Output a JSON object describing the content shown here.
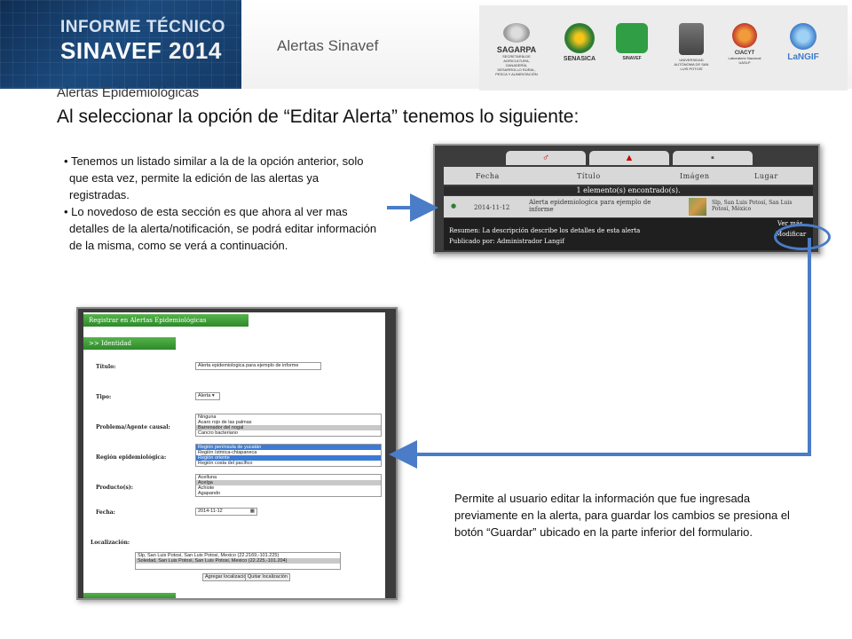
{
  "header": {
    "banner_line1": "INFORME TÉCNICO",
    "banner_line2": "SINAVEF",
    "banner_year": "2014",
    "section_title": "Alertas Sinavef",
    "logos": [
      {
        "name": "SAGARPA",
        "caption": "SECRETARÍA DE AGRICULTURA, GANADERÍA, DESARROLLO RURAL, PESCA Y ALIMENTACIÓN",
        "color": "#7a1f2b"
      },
      {
        "name": "SENASICA",
        "caption": "",
        "color": "#2e7d32"
      },
      {
        "name": "SINAVEF",
        "caption": "",
        "color": "#2f9e44"
      },
      {
        "name": "",
        "caption": "UNIVERSIDAD AUTÓNOMA DE SAN LUIS POTOSÍ",
        "color": "#555555"
      },
      {
        "name": "CIACYT",
        "caption": "Laboratorio Nacional UASLP",
        "color": "#d9822b"
      },
      {
        "name": "LaNGIF",
        "caption": "",
        "color": "#3d7dca"
      }
    ]
  },
  "subtitle": "Alertas Epidemiológicas",
  "main_title": "Al seleccionar la opción de “Editar Alerta” tenemos lo siguiente:",
  "bullets": [
    "Tenemos un listado similar a la de la opción anterior, solo que esta vez, permite la edición de las alertas ya registradas.",
    "Lo novedoso de esta sección es que ahora al ver mas detalles de la alerta/notificación, se podrá editar información de la misma, como se verá a continuación."
  ],
  "list_screenshot": {
    "columns": [
      "Fecha",
      "Título",
      "Imágen",
      "Lugar"
    ],
    "found_text": "1 elemento(s) encontrado(s).",
    "row": {
      "date": "2014-11-12",
      "title": "Alerta epidemiologica para ejemplo de informe",
      "place": "Slp, San Luis Potosí, San Luis Potosí, México"
    },
    "summary": "Resumen: La descripción describe los detalles de esta alerta",
    "published_by": "Publicado por: Administrador Langif",
    "see_more": "Ver más",
    "modify": "Modificar"
  },
  "form_screenshot": {
    "header": "Registrar en Alertas Epidemiológicas",
    "section": ">> Identidad",
    "fields": {
      "titulo_label": "Título:",
      "titulo_value": "Alerta epidemiologica para ejemplo de informe",
      "tipo_label": "Tipo:",
      "tipo_value": "Alerta",
      "problema_label": "Problema/Agente causal:",
      "problema_options": [
        "Ninguna",
        "Acaro rojo de las palmas",
        "Barrenador del nogal",
        "Cancro bacteriano"
      ],
      "region_label": "Región epidemiológica:",
      "region_options": [
        "Región península de yucatán",
        "Región ístmica-chiapaneca",
        "Región oriente",
        "Región costa del pacífico"
      ],
      "producto_label": "Producto(s):",
      "producto_options": [
        "Acelluna",
        "Acelga",
        "Achiote",
        "Agapando"
      ],
      "fecha_label": "Fecha:",
      "fecha_value": "2014-11-12",
      "localizacion_label": "Localización:",
      "localizacion_options": [
        "Slp, San Luis Potosi, San Luis Potosi, Mexico (22.2169,-101.225)",
        "Soledad, San Luis Potosi, San Luis Potosi, Mexico (22.225,-101.204)"
      ],
      "add_location": "Agregar localización",
      "remove_location": "Quitar localización"
    }
  },
  "description": "Permite al usuario editar la información que fue ingresada previamente en la alerta, para guardar los cambios se presiona el botón “Guardar” ubicado en la parte inferior del formulario.",
  "accent_color": "#4a7cc7"
}
